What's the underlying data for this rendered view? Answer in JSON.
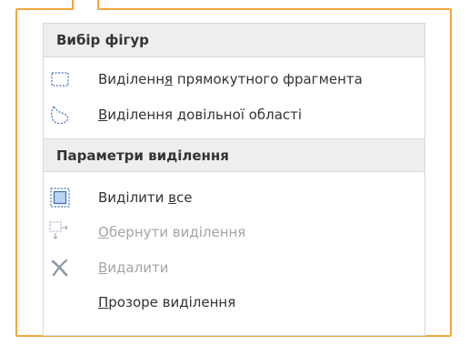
{
  "menu": {
    "section_shapes": {
      "title": "Вибір фігур"
    },
    "rect_select": {
      "pre": "Виділенн",
      "key": "я",
      "post": " прямокутного фрагмента",
      "icon": "rectangle-select-icon",
      "enabled": true
    },
    "free_select": {
      "pre": "",
      "key": "В",
      "post": "иділення довільної області",
      "icon": "freeform-select-icon",
      "enabled": true
    },
    "section_params": {
      "title": "Параметри виділення"
    },
    "select_all": {
      "pre": "Виділити ",
      "key": "в",
      "post": "се",
      "icon": "select-all-icon",
      "enabled": true
    },
    "invert_selection": {
      "pre": "",
      "key": "О",
      "post": "бернути виділення",
      "icon": "invert-selection-icon",
      "enabled": false
    },
    "delete": {
      "pre": "",
      "key": "В",
      "post": "идалити",
      "icon": "delete-x-icon",
      "enabled": false
    },
    "transparent_selection": {
      "pre": "",
      "key": "П",
      "post": "розоре виділення",
      "icon": "",
      "enabled": true
    }
  },
  "colors": {
    "highlight_frame": "#f2a73a",
    "header_bg": "#eeeeee",
    "text": "#333333",
    "disabled_text": "#a5a5a5",
    "icon_blue": "#3b6fb6"
  }
}
